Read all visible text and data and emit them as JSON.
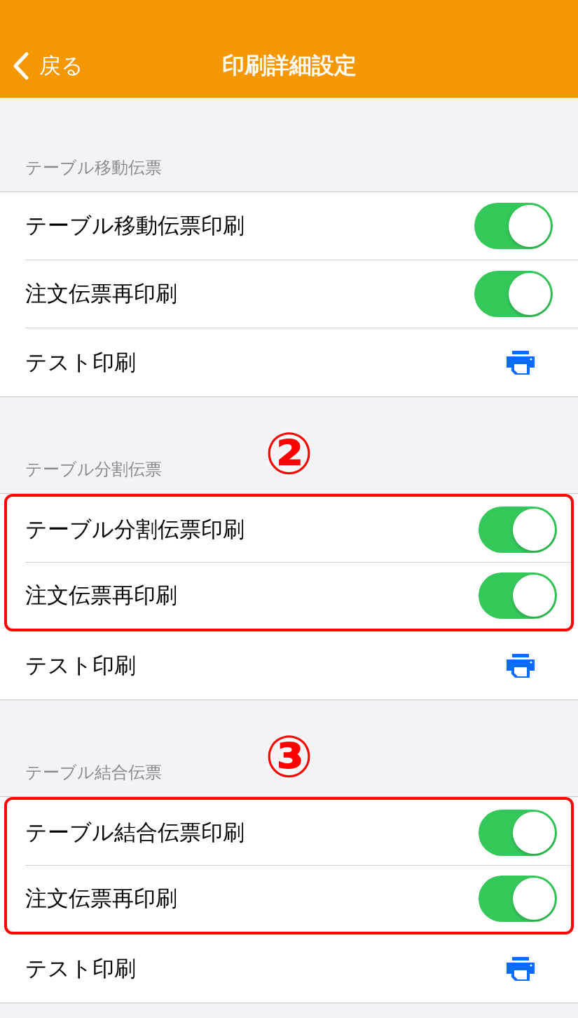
{
  "nav": {
    "back": "戻る",
    "title": "印刷詳細設定"
  },
  "sections": [
    {
      "header": "テーブル移動伝票",
      "rows": [
        {
          "kind": "toggle",
          "label": "テーブル移動伝票印刷",
          "on": true,
          "highlighted": false
        },
        {
          "kind": "toggle",
          "label": "注文伝票再印刷",
          "on": true,
          "highlighted": false
        },
        {
          "kind": "print",
          "label": "テスト印刷",
          "highlighted": false
        }
      ]
    },
    {
      "header": "テーブル分割伝票",
      "annotation": "②",
      "rows": [
        {
          "kind": "toggle",
          "label": "テーブル分割伝票印刷",
          "on": true,
          "highlighted": true
        },
        {
          "kind": "toggle",
          "label": "注文伝票再印刷",
          "on": true,
          "highlighted": true
        },
        {
          "kind": "print",
          "label": "テスト印刷",
          "highlighted": false
        }
      ]
    },
    {
      "header": "テーブル結合伝票",
      "annotation": "③",
      "rows": [
        {
          "kind": "toggle",
          "label": "テーブル結合伝票印刷",
          "on": true,
          "highlighted": true
        },
        {
          "kind": "toggle",
          "label": "注文伝票再印刷",
          "on": true,
          "highlighted": true
        },
        {
          "kind": "print",
          "label": "テスト印刷",
          "highlighted": false
        }
      ]
    }
  ]
}
